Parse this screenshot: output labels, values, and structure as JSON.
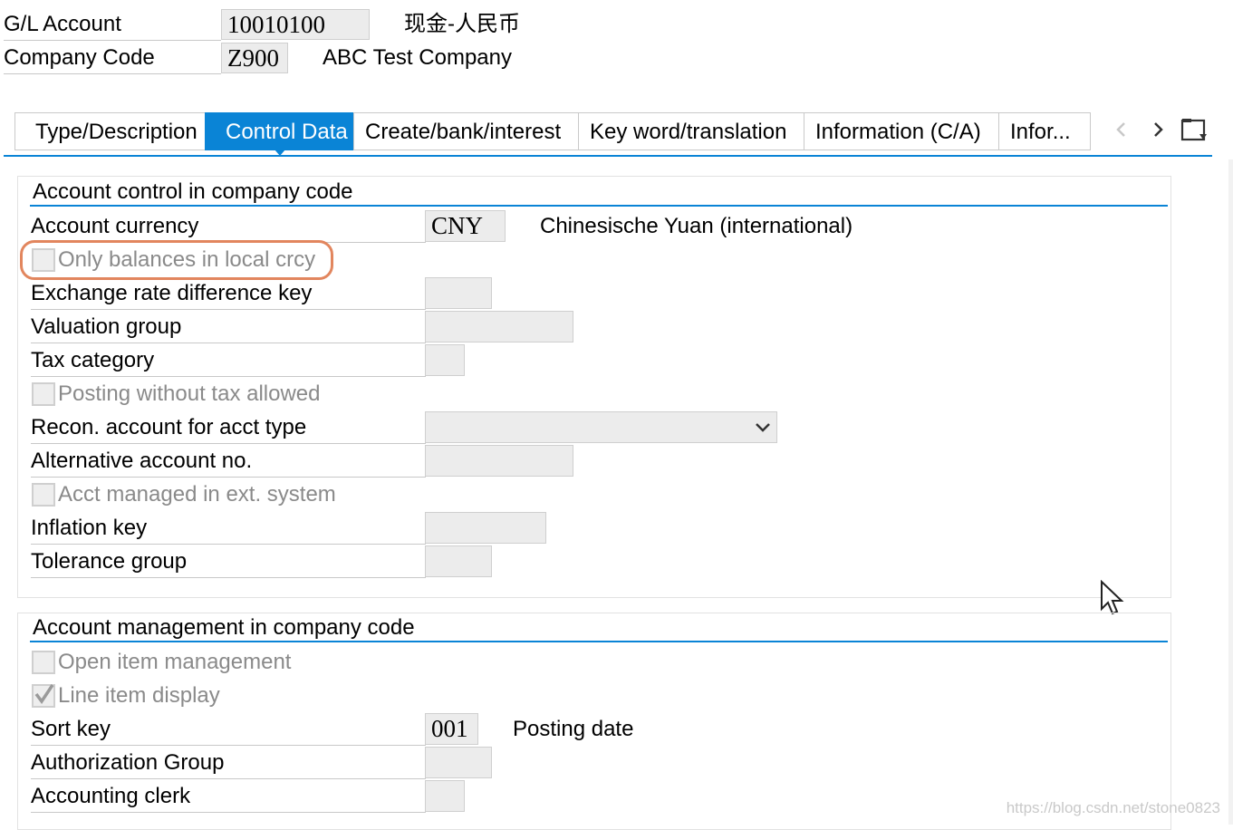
{
  "header": {
    "gl_account_label": "G/L Account",
    "gl_account_value": "10010100",
    "gl_account_desc": "现金-人民币",
    "company_code_label": "Company Code",
    "company_code_value": "Z900",
    "company_code_desc": "ABC Test Company"
  },
  "tabs": [
    {
      "label": "Type/Description",
      "active": false
    },
    {
      "label": "Control Data",
      "active": true
    },
    {
      "label": "Create/bank/interest",
      "active": false
    },
    {
      "label": "Key word/translation",
      "active": false
    },
    {
      "label": "Information (C/A)",
      "active": false
    },
    {
      "label": "Infor...",
      "active": false
    }
  ],
  "tab_nav_icons": [
    "chevron-left-icon",
    "chevron-right-icon",
    "tab-list-icon"
  ],
  "control_group": {
    "title": "Account control in company code",
    "account_currency_label": "Account currency",
    "account_currency_value": "CNY",
    "account_currency_desc": "Chinesische Yuan (international)",
    "only_balances_label": "Only balances in local crcy",
    "only_balances_checked": false,
    "exchange_rate_label": "Exchange rate difference key",
    "exchange_rate_value": "",
    "valuation_group_label": "Valuation group",
    "valuation_group_value": "",
    "tax_category_label": "Tax category",
    "tax_category_value": "",
    "posting_without_tax_label": "Posting without tax allowed",
    "posting_without_tax_checked": false,
    "recon_account_label": "Recon. account for acct type",
    "recon_account_value": "",
    "alt_account_label": "Alternative account no.",
    "alt_account_value": "",
    "acct_managed_ext_label": "Acct managed in ext. system",
    "acct_managed_ext_checked": false,
    "inflation_key_label": "Inflation key",
    "inflation_key_value": "",
    "tolerance_group_label": "Tolerance group",
    "tolerance_group_value": ""
  },
  "management_group": {
    "title": "Account management in company code",
    "open_item_label": "Open item management",
    "open_item_checked": false,
    "line_item_label": "Line item display",
    "line_item_checked": true,
    "sort_key_label": "Sort key",
    "sort_key_value": "001",
    "sort_key_desc": "Posting date",
    "auth_group_label": "Authorization Group",
    "auth_group_value": "",
    "accounting_clerk_label": "Accounting clerk",
    "accounting_clerk_value": ""
  },
  "watermark": "https://blog.csdn.net/stone0823",
  "colors": {
    "accent": "#0a84d6",
    "highlight": "#e2865e",
    "field_bg": "#ececec",
    "disabled_text": "#8a8a8a"
  }
}
